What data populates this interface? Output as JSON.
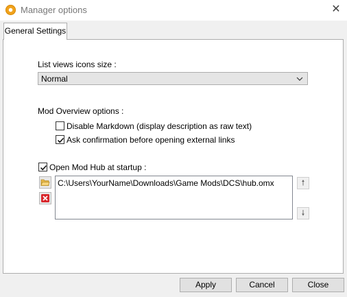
{
  "window": {
    "title": "Manager options",
    "close_glyph": "✕"
  },
  "tabs": [
    {
      "label": "General Settings",
      "selected": true
    }
  ],
  "general": {
    "icon_size_label": "List views icons size :",
    "icon_size_value": "Normal",
    "mod_overview_label": "Mod Overview options :",
    "disable_markdown": {
      "label": "Disable Markdown (display description as raw text)",
      "checked": false
    },
    "ask_confirmation": {
      "label": "Ask confirmation before opening external links",
      "checked": true
    },
    "open_mod_hub": {
      "label": "Open Mod Hub at startup :",
      "checked": true
    },
    "hub_paths": [
      "C:\\Users\\YourName\\Downloads\\Game Mods\\DCS\\hub.omx"
    ],
    "move_up_glyph": "🠕",
    "move_down_glyph": "🠗"
  },
  "buttons": {
    "apply": "Apply",
    "cancel": "Cancel",
    "close": "Close"
  },
  "icons": {
    "app": "gear-icon",
    "add": "folder-open-icon",
    "remove": "delete-icon",
    "up": "arrow-up-icon",
    "down": "arrow-down-icon"
  },
  "colors": {
    "folder": "#e8b94a",
    "delete": "#d9262b",
    "app_icon": "#f0a21c"
  }
}
